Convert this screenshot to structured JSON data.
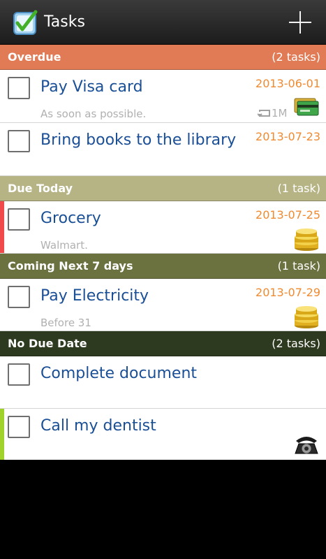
{
  "app": {
    "title": "Tasks",
    "icon": "checkbox-checked-icon",
    "add_icon": "plus-icon"
  },
  "colors": {
    "overdue": "#e07b55",
    "due_today": "#b6b385",
    "coming": "#6b7240",
    "no_due": "#2e3a1f",
    "title_blue": "#1a4f96",
    "date_orange": "#f08a30",
    "priority_red": "#f04a4a",
    "priority_green": "#a0d22c"
  },
  "sections": [
    {
      "title": "Overdue",
      "count": "(2 tasks)",
      "tasks": [
        {
          "title": "Pay Visa card",
          "date": "2013-06-01",
          "note": "As soon as possible.",
          "repeat": "1M",
          "icon": "credit-card-icon"
        },
        {
          "title": "Bring books to the library",
          "date": "2013-07-23"
        }
      ]
    },
    {
      "title": "Due Today",
      "count": "(1 task)",
      "tasks": [
        {
          "title": "Grocery",
          "date": "2013-07-25",
          "note": "Walmart.",
          "icon": "coins-icon",
          "priority": "red"
        }
      ]
    },
    {
      "title": "Coming Next 7 days",
      "count": "(1 task)",
      "tasks": [
        {
          "title": "Pay Electricity",
          "date": "2013-07-29",
          "note": "Before 31",
          "icon": "coins-icon"
        }
      ]
    },
    {
      "title": "No Due Date",
      "count": "(2 tasks)",
      "tasks": [
        {
          "title": "Complete document"
        },
        {
          "title": "Call my dentist",
          "icon": "rotary-phone-icon",
          "priority": "green"
        }
      ]
    }
  ]
}
